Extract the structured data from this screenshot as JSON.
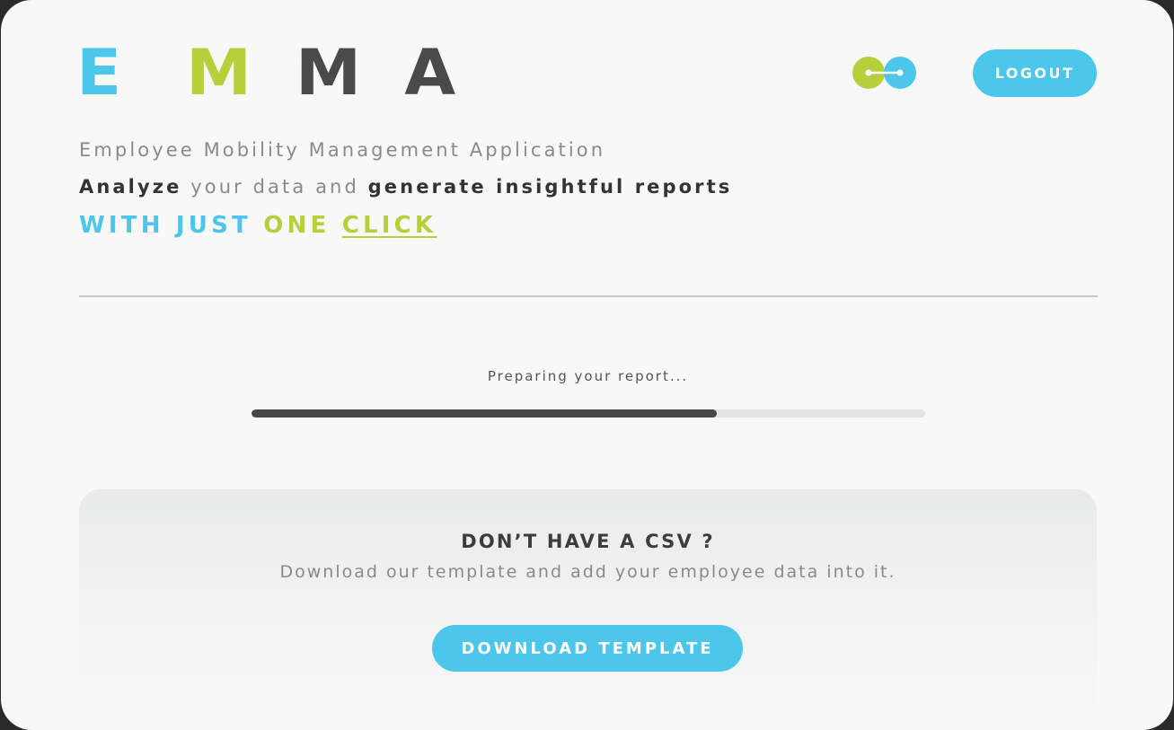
{
  "colors": {
    "accent_blue": "#4dc6ec",
    "accent_green": "#b6cf3a",
    "dark_text": "#333333",
    "muted_text": "#8a8a8a",
    "background": "#f8f8f8"
  },
  "header": {
    "logo_letters": [
      "E",
      "M",
      "M",
      "A"
    ],
    "connect_icon": "connection-toggle-icon",
    "logout_label": "LOGOUT"
  },
  "tagline": {
    "subtitle": "Employee Mobility Management Application",
    "analyze_word": "Analyze",
    "your_data_and": " your data and ",
    "generate_reports": "generate insightful reports",
    "with_just": "WITH JUST ",
    "one": "ONE ",
    "click": "CLICK"
  },
  "progress": {
    "status": "Preparing your report...",
    "value": 0.69
  },
  "csv_panel": {
    "title": "DON’T HAVE A CSV ?",
    "description": "Download our template and add your employee data into it.",
    "button_label": "DOWNLOAD TEMPLATE"
  }
}
